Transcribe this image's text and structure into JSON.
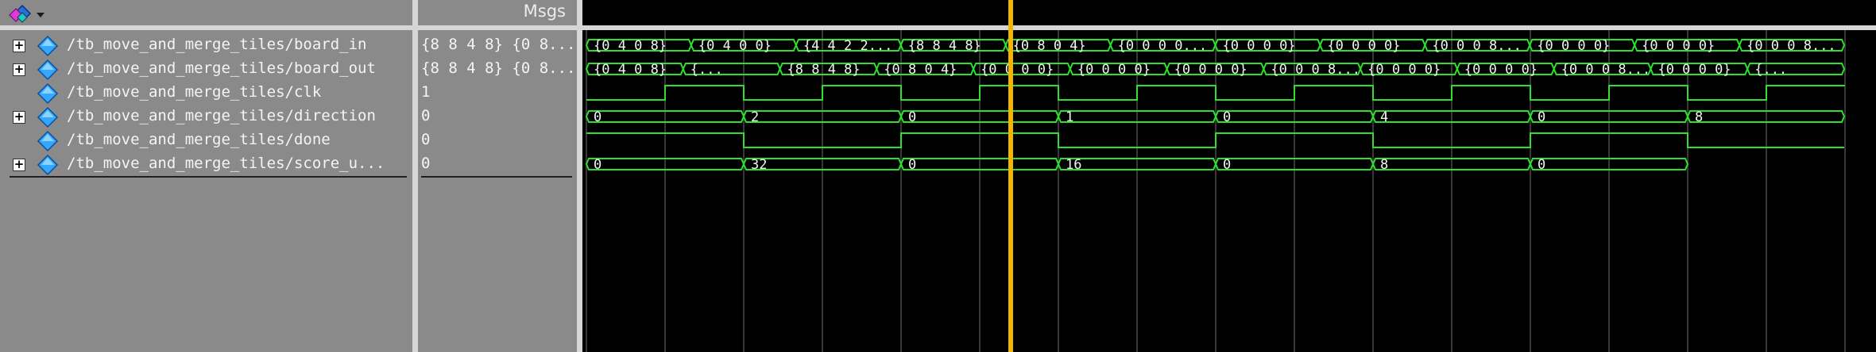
{
  "values_header": "Msgs",
  "signals": [
    {
      "name": "/tb_move_and_merge_tiles/board_in",
      "value": "{8 8 4 8} {0 8...",
      "expandable": true
    },
    {
      "name": "/tb_move_and_merge_tiles/board_out",
      "value": "{8 8 4 8} {0 8...",
      "expandable": true
    },
    {
      "name": "/tb_move_and_merge_tiles/clk",
      "value": "1",
      "expandable": false
    },
    {
      "name": "/tb_move_and_merge_tiles/direction",
      "value": "0",
      "expandable": true
    },
    {
      "name": "/tb_move_and_merge_tiles/done",
      "value": "0",
      "expandable": false
    },
    {
      "name": "/tb_move_and_merge_tiles/score_u...",
      "value": "0",
      "expandable": true
    }
  ],
  "expander_glyph": "+",
  "waves": {
    "board_in": [
      "{0 4 0 8}",
      "{0 4 0 0}",
      "{4 4 2 2...",
      "{8 8 4 8}",
      "{0 8 0 4}",
      "{0 0 0 0...",
      "{0 0 0 0}",
      "{0 0 0 0}",
      "{0 0 0 8...",
      "{0 0 0 0}",
      "{0 0 0 0}",
      "{0 0 0 8..."
    ],
    "board_out": [
      "{0 4 0 8}",
      "{...",
      "{8 8 4 8}",
      "{0 8 0 4}",
      "{0 0 0 0}",
      "{0 0 0 0}",
      "{0 0 0 0}",
      "{0 0 0 8...",
      "{0 0 0 0}",
      "{0 0 0 0}",
      "{0 0 0 8...",
      "{0 0 0 0}",
      "{..."
    ],
    "direction": [
      "0",
      "2",
      "0",
      "1",
      "0",
      "4",
      "0",
      "8"
    ],
    "score_update": [
      "0",
      "32",
      "0",
      "16",
      "0",
      "8",
      "0"
    ]
  },
  "colors": {
    "pane_bg": "#8a8a8a",
    "wave_bg": "#000000",
    "wave_green": "#2de02d",
    "grid": "#4a4a4a",
    "cursor": "#f2b600",
    "divider": "#d6d6d6",
    "text": "#f4f4f4"
  },
  "icons": {
    "toolbar": "wave-tool-icon",
    "signal": "signal-diamond-icon",
    "expander": "expand-plus-icon"
  }
}
